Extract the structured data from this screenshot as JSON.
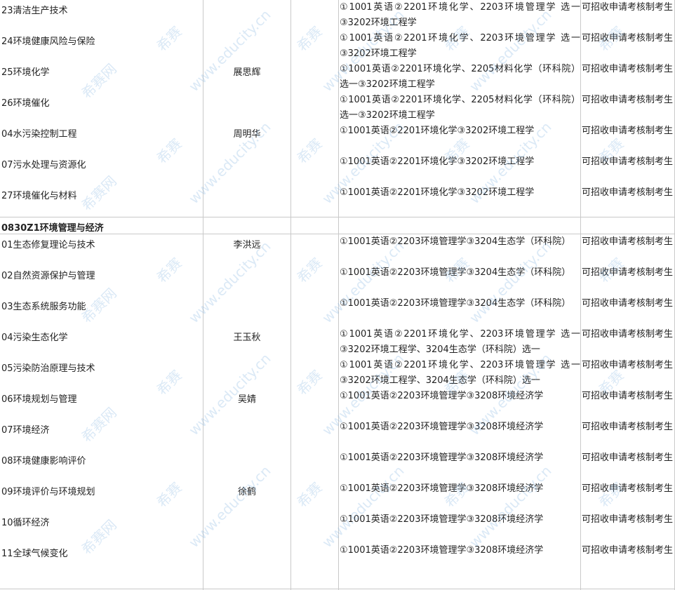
{
  "rows": [
    {
      "dir": "23清洁生产技术",
      "sup": "",
      "exam": "①1001英语②2201环境化学、2203环境管理学 选一③3202环境工程学",
      "note": "可招收申请考核制考生"
    },
    {
      "dir": "24环境健康风险与保险",
      "sup": "",
      "exam": "①1001英语②2201环境化学、2203环境管理学 选一③3202环境工程学",
      "note": "可招收申请考核制考生"
    },
    {
      "dir": "25环境化学",
      "sup": "展思辉",
      "exam": "①1001英语②2201环境化学、2205材料化学（环科院）选一③3202环境工程学",
      "note": "可招收申请考核制考生"
    },
    {
      "dir": "26环境催化",
      "sup": "",
      "exam": "①1001英语②2201环境化学、2205材料化学（环科院）选一③3202环境工程学",
      "note": "可招收申请考核制考生"
    },
    {
      "dir": "04水污染控制工程",
      "sup": "周明华",
      "exam": "①1001英语②2201环境化学③3202环境工程学",
      "note": "可招收申请考核制考生"
    },
    {
      "dir": "07污水处理与资源化",
      "sup": "",
      "exam": "①1001英语②2201环境化学③3202环境工程学",
      "note": "可招收申请考核制考生"
    },
    {
      "dir": "27环境催化与材料",
      "sup": "",
      "exam": "①1001英语②2201环境化学③3202环境工程学",
      "note": "可招收申请考核制考生"
    },
    {
      "dir": "01生态修复理论与技术",
      "sup": "李洪远",
      "exam": "①1001英语②2203环境管理学③3204生态学（环科院）",
      "note": "可招收申请考核制考生"
    },
    {
      "dir": "02自然资源保护与管理",
      "sup": "",
      "exam": "①1001英语②2203环境管理学③3204生态学（环科院）",
      "note": "可招收申请考核制考生"
    },
    {
      "dir": "03生态系统服务功能",
      "sup": "",
      "exam": "①1001英语②2203环境管理学③3204生态学（环科院）",
      "note": "可招收申请考核制考生"
    },
    {
      "dir": "04污染生态化学",
      "sup": "王玉秋",
      "exam": "①1001英语②2201环境化学、2203环境管理学 选一③3202环境工程学、3204生态学（环科院）选一",
      "note": "可招收申请考核制考生"
    },
    {
      "dir": "05污染防治原理与技术",
      "sup": "",
      "exam": "①1001英语②2201环境化学、2203环境管理学 选一③3202环境工程学、3204生态学（环科院）选一",
      "note": "可招收申请考核制考生"
    },
    {
      "dir": "06环境规划与管理",
      "sup": "吴婧",
      "exam": "①1001英语②2203环境管理学③3208环境经济学",
      "note": "可招收申请考核制考生"
    },
    {
      "dir": "07环境经济",
      "sup": "",
      "exam": "①1001英语②2203环境管理学③3208环境经济学",
      "note": "可招收申请考核制考生"
    },
    {
      "dir": "08环境健康影响评价",
      "sup": "",
      "exam": "①1001英语②2203环境管理学③3208环境经济学",
      "note": "可招收申请考核制考生"
    },
    {
      "dir": "09环境评价与环境规划",
      "sup": "徐鹤",
      "exam": "①1001英语②2203环境管理学③3208环境经济学",
      "note": "可招收申请考核制考生"
    },
    {
      "dir": "10循环经济",
      "sup": "",
      "exam": "①1001英语②2203环境管理学③3208环境经济学",
      "note": "可招收申请考核制考生"
    },
    {
      "dir": "11全球气候变化",
      "sup": "",
      "exam": "①1001英语②2203环境管理学③3208环境经济学",
      "note": "可招收申请考核制考生"
    }
  ],
  "section": {
    "title": "0830Z1环境管理与经济"
  },
  "watermark": {
    "brand": "希赛网",
    "site": "www.educity.cn",
    "logo": "希赛"
  }
}
